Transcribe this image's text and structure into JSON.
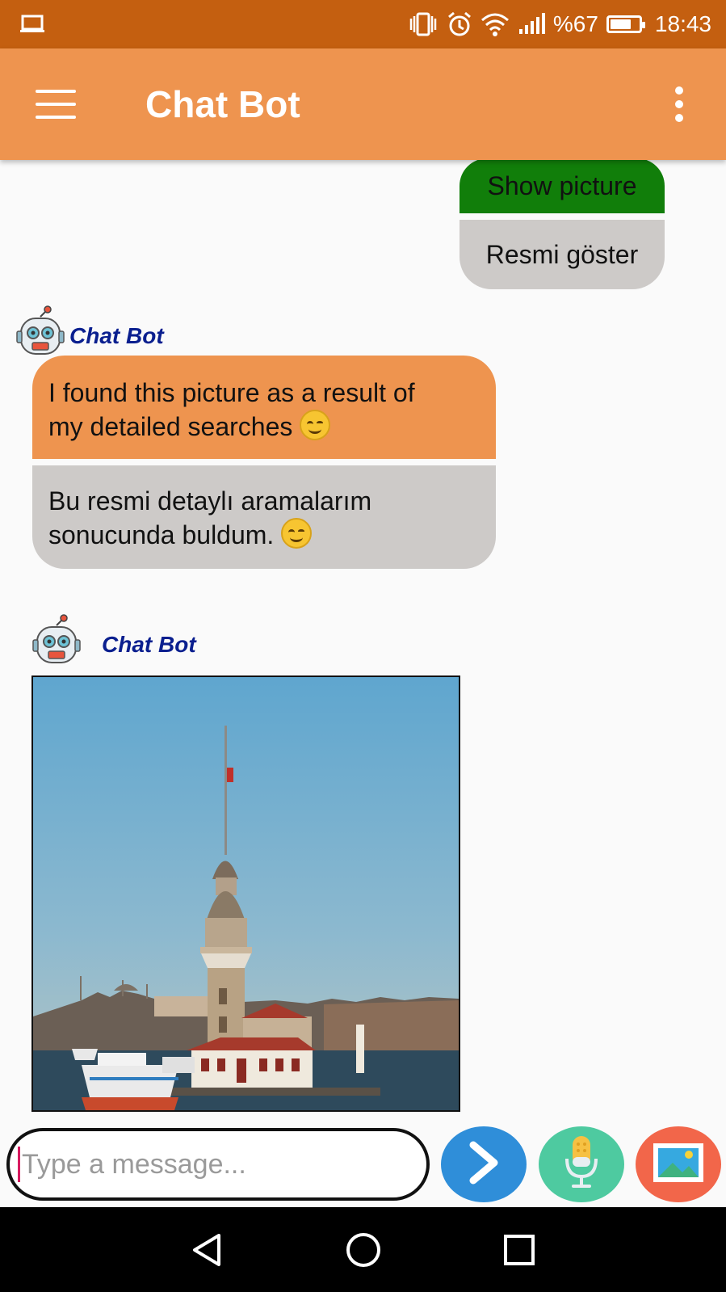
{
  "status_bar": {
    "battery_text": "%67",
    "battery_level": 0.67,
    "time": "18:43",
    "icons": [
      "laptop-icon",
      "vibrate-icon",
      "alarm-icon",
      "wifi-icon",
      "signal-icon",
      "battery-icon"
    ]
  },
  "app_bar": {
    "title": "Chat Bot",
    "icons": [
      "menu-icon",
      "overflow-menu-icon"
    ]
  },
  "conversation": {
    "user_message": {
      "original": "Show picture",
      "translation": "Resmi göster"
    },
    "bot_messages": [
      {
        "sender": "Chat Bot",
        "line1": "I found this picture as a result of",
        "line2": "my detailed searches",
        "translation_line1": "Bu resmi detaylı aramalarım",
        "translation_line2": "sonucunda buldum."
      },
      {
        "sender": "Chat Bot",
        "image_subject": "maiden-tower-photo"
      }
    ]
  },
  "composer": {
    "placeholder": "Type a message...",
    "buttons": [
      "send-icon",
      "microphone-icon",
      "image-icon"
    ]
  },
  "nav_bar": {
    "buttons": [
      "back-icon",
      "home-icon",
      "recents-icon"
    ]
  },
  "colors": {
    "status_bar": "#c45f10",
    "app_bar": "#ee944f",
    "user_bubble_top": "#117e0a",
    "translation_bubble": "#cdcac8",
    "bot_bubble_top": "#ee944f",
    "bot_name": "#0a1f8f",
    "send_button": "#2f8ed9",
    "mic_button": "#4ecaa0",
    "image_button": "#f2664a"
  }
}
